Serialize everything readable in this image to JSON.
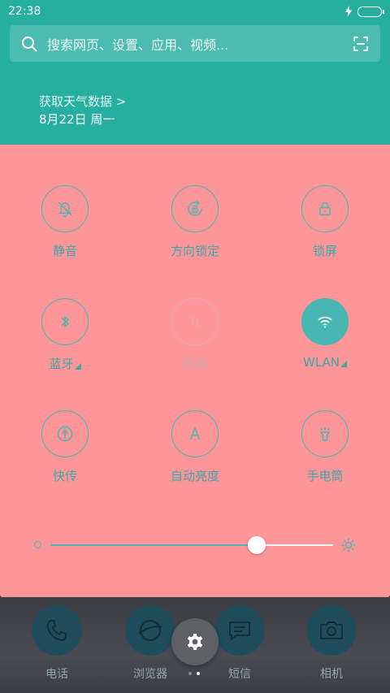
{
  "status": {
    "time": "22:38"
  },
  "search": {
    "placeholder": "搜索网页、设置、应用、视频..."
  },
  "weather": {
    "link": "获取天气数据 >",
    "date": "8月22日 周一"
  },
  "tiles": [
    {
      "label": "静音",
      "icon": "bell-off-icon"
    },
    {
      "label": "方向锁定",
      "icon": "rotation-lock-icon"
    },
    {
      "label": "锁屏",
      "icon": "lock-icon"
    },
    {
      "label": "蓝牙",
      "icon": "bluetooth-icon"
    },
    {
      "label": "数据",
      "icon": "mobile-data-icon"
    },
    {
      "label": "WLAN",
      "icon": "wifi-icon"
    },
    {
      "label": "快传",
      "icon": "quick-share-icon"
    },
    {
      "label": "自动亮度",
      "icon": "auto-brightness-icon"
    },
    {
      "label": "手电筒",
      "icon": "flashlight-icon"
    }
  ],
  "brightness": {
    "level": 0.73
  },
  "dock": [
    {
      "label": "电话",
      "icon": "phone-icon"
    },
    {
      "label": "浏览器",
      "icon": "browser-icon"
    },
    {
      "label": "短信",
      "icon": "message-icon"
    },
    {
      "label": "相机",
      "icon": "camera-icon"
    }
  ],
  "colors": {
    "teal": "#26ae9f",
    "panel": "#fe9598",
    "accent": "#48b6b2"
  }
}
